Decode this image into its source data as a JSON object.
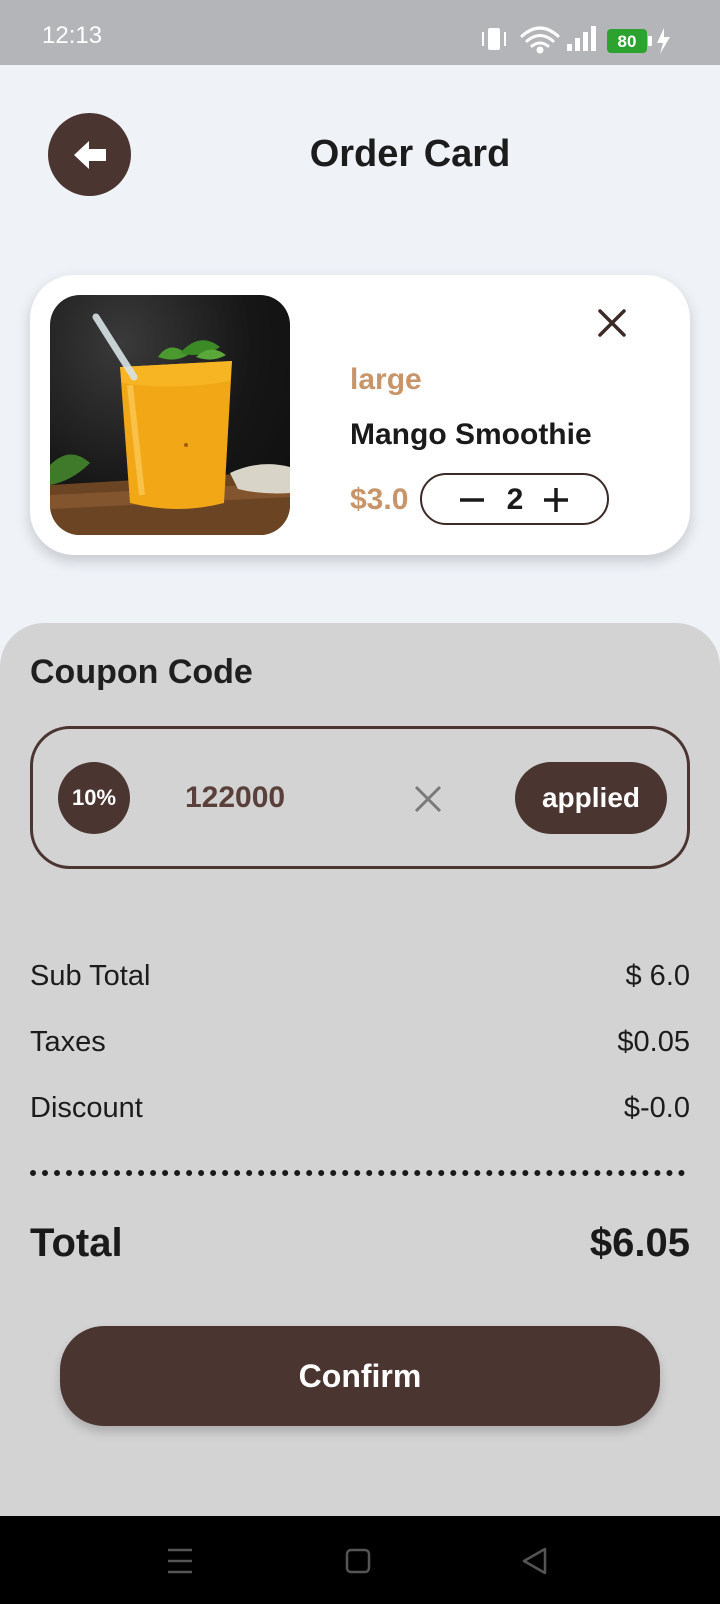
{
  "status_bar": {
    "time": "12:13",
    "battery": "80"
  },
  "header": {
    "title": "Order Card"
  },
  "cart_item": {
    "size": "large",
    "name": "Mango Smoothie",
    "price": "$3.0",
    "quantity": "2"
  },
  "coupon": {
    "title": "Coupon Code",
    "badge": "10%",
    "code": "122000",
    "apply_label": "applied"
  },
  "summary": {
    "subtotal_label": "Sub Total",
    "subtotal_value": "$ 6.0",
    "taxes_label": "Taxes",
    "taxes_value": "$0.05",
    "discount_label": "Discount",
    "discount_value": "$-0.0",
    "total_label": "Total",
    "total_value": "$6.05"
  },
  "actions": {
    "confirm_label": "Confirm"
  },
  "colors": {
    "primary": "#4b3531",
    "accent": "#c8956a",
    "background": "#eff3f8",
    "sheet": "#d3d3d3"
  }
}
